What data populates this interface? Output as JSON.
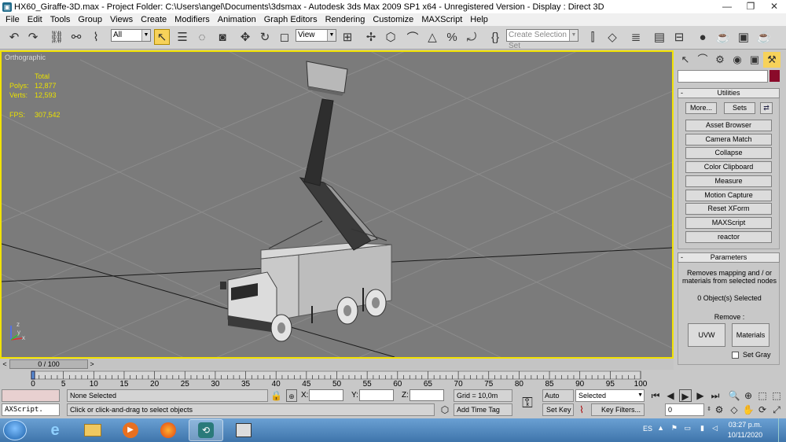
{
  "window": {
    "title": "HX60_Giraffe-3D.max    - Project Folder: C:\\Users\\angel\\Documents\\3dsmax    - Autodesk 3ds Max  2009 SP1  x64    - Unregistered Version    - Display : Direct 3D",
    "controls": [
      "—",
      "❐",
      "✕"
    ]
  },
  "menu": [
    "File",
    "Edit",
    "Tools",
    "Group",
    "Views",
    "Create",
    "Modifiers",
    "Animation",
    "Graph Editors",
    "Rendering",
    "Customize",
    "MAXScript",
    "Help"
  ],
  "toolbar": {
    "selection_filter": "All",
    "reference_coord": "View",
    "named_selection_placeholder": "Create Selection Set"
  },
  "viewport": {
    "label": "Orthographic",
    "stats": {
      "total_label": "Total",
      "polys_label": "Polys:",
      "polys_value": "12,877",
      "verts_label": "Verts:",
      "verts_value": "12,593",
      "fps_label": "FPS:",
      "fps_value": "307,542"
    },
    "axis_x": "x",
    "axis_y": "y",
    "axis_z": "z"
  },
  "command_panel": {
    "utilities": {
      "header": "Utilities",
      "more_label": "More...",
      "sets_label": "Sets",
      "buttons": [
        "Asset Browser",
        "Camera Match",
        "Collapse",
        "Color Clipboard",
        "Measure",
        "Motion Capture",
        "Reset XForm",
        "MAXScript",
        "reactor"
      ]
    },
    "parameters": {
      "header": "Parameters",
      "description": "Removes mapping and / or materials from selected nodes",
      "selected_count": "0 Object(s) Selected",
      "remove_label": "Remove :",
      "uvw_label": "UVW",
      "materials_label": "Materials",
      "set_gray_label": "Set Gray",
      "set_gray_checked": false
    }
  },
  "time_slider": {
    "frame_label": "0 / 100",
    "current_frame": 0,
    "total_frames": 100
  },
  "track_ticks": [
    "0",
    "5",
    "10",
    "15",
    "20",
    "25",
    "30",
    "35",
    "40",
    "45",
    "50",
    "55",
    "60",
    "65",
    "70",
    "75",
    "80",
    "85",
    "90",
    "95",
    "100"
  ],
  "status": {
    "maxscript_label": "AXScript.",
    "selection": "None Selected",
    "prompt": "Click or click-and-drag to select objects",
    "x_label": "X:",
    "y_label": "Y:",
    "z_label": "Z:",
    "grid": "Grid = 10,0m",
    "add_time_tag": "Add Time Tag",
    "auto_key": "Auto Key",
    "set_key": "Set Key",
    "key_mode": "Selected",
    "key_filters": "Key Filters...",
    "frame_value": "0"
  },
  "taskbar": {
    "language": "ES",
    "time": "03:27 p.m.",
    "date": "10/11/2020"
  },
  "colors": {
    "viewport_bg": "#7b7b7b",
    "viewport_border": "#f2e200",
    "stats_text": "#e9e000",
    "object_color": "#8a0a2a",
    "taskbar": "#4a80b8"
  }
}
